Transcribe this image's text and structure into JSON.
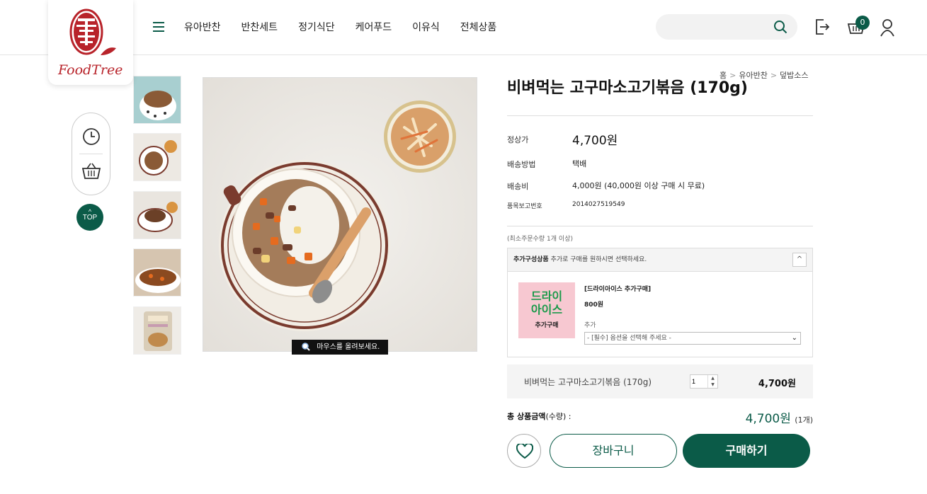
{
  "brand": {
    "logo_text": "FoodTree",
    "accent": "#0b5b48",
    "logo_red": "#b8232a"
  },
  "nav": {
    "items": [
      "유아반찬",
      "반찬세트",
      "정기식단",
      "케어푸드",
      "이유식",
      "전체상품"
    ]
  },
  "header": {
    "cart_count": "0",
    "search_placeholder": ""
  },
  "sidebar": {
    "top_label": "TOP"
  },
  "gallery": {
    "zoom_hint": "마우스를 올려보세요."
  },
  "breadcrumb": [
    "홈",
    "유아반찬",
    "덮밥소스"
  ],
  "product": {
    "title": "비벼먹는 고구마소고기볶음 (170g)",
    "rows": [
      {
        "label": "정상가",
        "value": "4,700원"
      },
      {
        "label": "배송방법",
        "value": "택배"
      },
      {
        "label": "배송비",
        "value": "4,000원 (40,000원 이상 구매 시 무료)"
      },
      {
        "label": "품목보고번호",
        "value": "2014027519549"
      }
    ],
    "min_order": "(최소주문수량 1개 이상)"
  },
  "addon": {
    "head_bold": "추가구성상품",
    "head_text": "추가로 구매를 원하시면 선택하세요.",
    "image_line1": "드라이",
    "image_line2": "아이스",
    "image_line3": "추가구매",
    "name": "[드라이아이스 추가구매]",
    "price": "800원",
    "add_label": "추가",
    "select_value": "- [필수] 옵션을 선택해 주세요 -"
  },
  "selection": {
    "name": "비벼먹는 고구마소고기볶음 (170g)",
    "quantity": "1",
    "price": "4,700원"
  },
  "total": {
    "label_bold": "총 상품금액",
    "label_rest": "(수량) :",
    "price": "4,700원",
    "qty": "(1개)"
  },
  "actions": {
    "cart": "장바구니",
    "buy": "구매하기"
  }
}
